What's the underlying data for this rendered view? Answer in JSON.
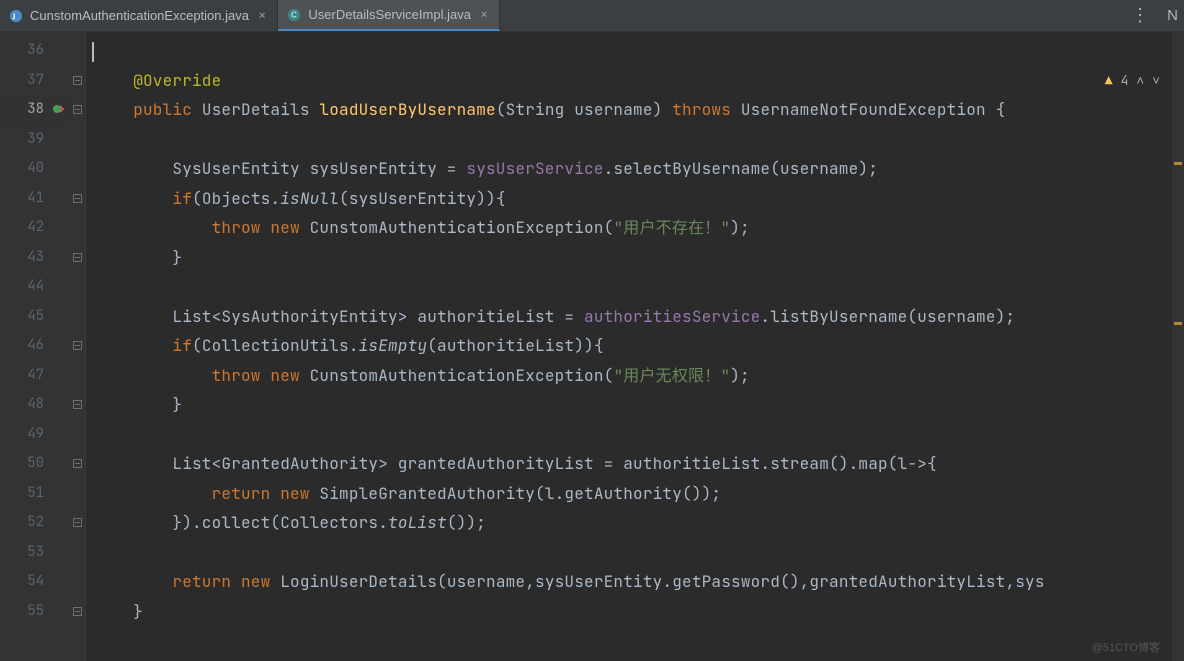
{
  "tabs": [
    {
      "label": "CunstomAuthenticationException.java",
      "active": false
    },
    {
      "label": "UserDetailsServiceImpl.java",
      "active": true
    }
  ],
  "rightLetter": "N",
  "inspection": {
    "count": "4"
  },
  "gutter": {
    "start": 36,
    "end": 55,
    "highlighted": 38
  },
  "code": {
    "lines": [
      {
        "n": 36,
        "segs": [
          {
            "t": "",
            "c": ""
          }
        ],
        "cursor": true
      },
      {
        "n": 37,
        "segs": [
          {
            "t": "    ",
            "c": ""
          },
          {
            "t": "@Override",
            "c": "ann"
          }
        ]
      },
      {
        "n": 38,
        "segs": [
          {
            "t": "    ",
            "c": ""
          },
          {
            "t": "public ",
            "c": "kw"
          },
          {
            "t": "UserDetails ",
            "c": "type"
          },
          {
            "t": "loadUserByUsername",
            "c": "method-decl"
          },
          {
            "t": "(String username) ",
            "c": "type"
          },
          {
            "t": "throws ",
            "c": "kw"
          },
          {
            "t": "UsernameNotFoundException {",
            "c": "type"
          }
        ]
      },
      {
        "n": 39,
        "segs": [
          {
            "t": "",
            "c": ""
          }
        ]
      },
      {
        "n": 40,
        "segs": [
          {
            "t": "        SysUserEntity sysUserEntity = ",
            "c": "type"
          },
          {
            "t": "sysUserService",
            "c": "field"
          },
          {
            "t": ".selectByUsername(username);",
            "c": "type"
          }
        ]
      },
      {
        "n": 41,
        "segs": [
          {
            "t": "        ",
            "c": ""
          },
          {
            "t": "if",
            "c": "kw"
          },
          {
            "t": "(Objects.",
            "c": "type"
          },
          {
            "t": "isNull",
            "c": "italic"
          },
          {
            "t": "(sysUserEntity)){",
            "c": "type"
          }
        ]
      },
      {
        "n": 42,
        "segs": [
          {
            "t": "            ",
            "c": ""
          },
          {
            "t": "throw new ",
            "c": "kw"
          },
          {
            "t": "CunstomAuthenticationException(",
            "c": "type"
          },
          {
            "t": "\"用户不存在！\"",
            "c": "str"
          },
          {
            "t": ");",
            "c": "type"
          }
        ]
      },
      {
        "n": 43,
        "segs": [
          {
            "t": "        }",
            "c": "type"
          }
        ]
      },
      {
        "n": 44,
        "segs": [
          {
            "t": "",
            "c": ""
          }
        ]
      },
      {
        "n": 45,
        "segs": [
          {
            "t": "        List<SysAuthorityEntity> authoritieList = ",
            "c": "type"
          },
          {
            "t": "authoritiesService",
            "c": "field"
          },
          {
            "t": ".listByUsername(username);",
            "c": "type"
          }
        ]
      },
      {
        "n": 46,
        "segs": [
          {
            "t": "        ",
            "c": ""
          },
          {
            "t": "if",
            "c": "kw"
          },
          {
            "t": "(CollectionUtils.",
            "c": "type"
          },
          {
            "t": "isEmpty",
            "c": "italic"
          },
          {
            "t": "(authoritieList)){",
            "c": "type"
          }
        ]
      },
      {
        "n": 47,
        "segs": [
          {
            "t": "            ",
            "c": ""
          },
          {
            "t": "throw new ",
            "c": "kw"
          },
          {
            "t": "CunstomAuthenticationException(",
            "c": "type"
          },
          {
            "t": "\"用户无权限！\"",
            "c": "str"
          },
          {
            "t": ");",
            "c": "type"
          }
        ]
      },
      {
        "n": 48,
        "segs": [
          {
            "t": "        }",
            "c": "type"
          }
        ]
      },
      {
        "n": 49,
        "segs": [
          {
            "t": "",
            "c": ""
          }
        ]
      },
      {
        "n": 50,
        "segs": [
          {
            "t": "        List<GrantedAuthority> grantedAuthorityList = authoritieList.stream().map(l->{",
            "c": "type"
          }
        ]
      },
      {
        "n": 51,
        "segs": [
          {
            "t": "            ",
            "c": ""
          },
          {
            "t": "return new ",
            "c": "kw"
          },
          {
            "t": "SimpleGrantedAuthority(l.getAuthority());",
            "c": "type"
          }
        ]
      },
      {
        "n": 52,
        "segs": [
          {
            "t": "        }).collect(Collectors.",
            "c": "type"
          },
          {
            "t": "toList",
            "c": "italic"
          },
          {
            "t": "());",
            "c": "type"
          }
        ]
      },
      {
        "n": 53,
        "segs": [
          {
            "t": "",
            "c": ""
          }
        ]
      },
      {
        "n": 54,
        "segs": [
          {
            "t": "        ",
            "c": ""
          },
          {
            "t": "return new ",
            "c": "kw"
          },
          {
            "t": "LoginUserDetails(username,sysUserEntity.getPassword(),grantedAuthorityList,sys",
            "c": "type"
          }
        ]
      },
      {
        "n": 55,
        "segs": [
          {
            "t": "    }",
            "c": "type"
          }
        ]
      }
    ]
  },
  "watermark": "@51CTO博客"
}
